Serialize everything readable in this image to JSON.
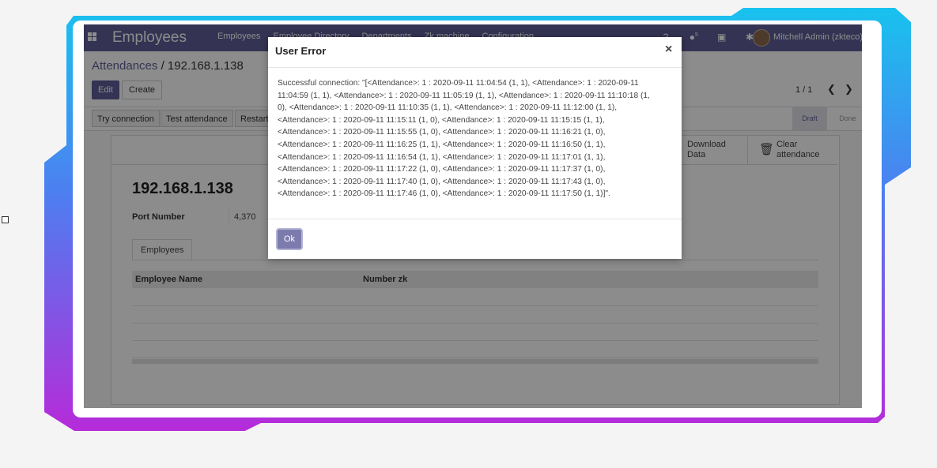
{
  "colors": {
    "brand": "#5f5e97",
    "frame_cyan": "#1fb7f0",
    "frame_purple": "#b02bd8"
  },
  "navbar": {
    "app_name": "Employees",
    "menu": [
      "Employees",
      "Employee Directory",
      "Departments",
      "Zk machine",
      "Configuration"
    ],
    "message_count": "5",
    "user": "Mitchell Admin (zkteco)"
  },
  "control_panel": {
    "breadcrumb_parent": "Attendances",
    "breadcrumb_sep": "/",
    "breadcrumb_current": "192.168.1.138",
    "edit_label": "Edit",
    "create_label": "Create",
    "pager": "1 / 1"
  },
  "header_buttons": [
    "Try connection",
    "Test attendance",
    "Restart"
  ],
  "stages": {
    "draft": "Draft",
    "done": "Done"
  },
  "smart_buttons": {
    "download": [
      "Download",
      "Data"
    ],
    "clear": [
      "Clear",
      "attendance"
    ]
  },
  "form": {
    "title": "192.168.1.138",
    "port_label": "Port Number",
    "port_value": "4,370",
    "tab_label": "Employees",
    "columns": [
      "Employee Name",
      "Number zk"
    ]
  },
  "dialog": {
    "title": "User Error",
    "close": "×",
    "lines": [
      "Successful connection:  \"[<Attendance>: 1 : 2020-09-11 11:04:54 (1, 1), <Attendance>: 1 : 2020-09-11",
      "11:04:59 (1, 1), <Attendance>: 1 : 2020-09-11 11:05:19 (1, 1), <Attendance>: 1 : 2020-09-11 11:10:18 (1,",
      "0), <Attendance>: 1 : 2020-09-11 11:10:35 (1, 1), <Attendance>: 1 : 2020-09-11 11:12:00 (1, 1),",
      "<Attendance>: 1 : 2020-09-11 11:15:11 (1, 0), <Attendance>: 1 : 2020-09-11 11:15:15 (1, 1),",
      "<Attendance>: 1 : 2020-09-11 11:15:55 (1, 0), <Attendance>: 1 : 2020-09-11 11:16:21 (1, 0),",
      "<Attendance>: 1 : 2020-09-11 11:16:25 (1, 1), <Attendance>: 1 : 2020-09-11 11:16:50 (1, 1),",
      "<Attendance>: 1 : 2020-09-11 11:16:54 (1, 1), <Attendance>: 1 : 2020-09-11 11:17:01 (1, 1),",
      "<Attendance>: 1 : 2020-09-11 11:17:22 (1, 0), <Attendance>: 1 : 2020-09-11 11:17:37 (1, 0),",
      "<Attendance>: 1 : 2020-09-11 11:17:40 (1, 0), <Attendance>: 1 : 2020-09-11 11:17:43 (1, 0),",
      "<Attendance>: 1 : 2020-09-11 11:17:46 (1, 0), <Attendance>: 1 : 2020-09-11 11:17:50 (1, 1)]\"."
    ],
    "ok_label": "Ok"
  }
}
